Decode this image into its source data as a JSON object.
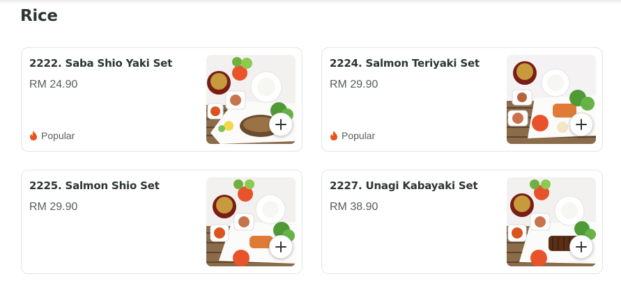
{
  "section": {
    "title": "Rice"
  },
  "items": [
    {
      "name": "2222. Saba Shio Yaki Set",
      "price": "RM 24.90",
      "badge": "Popular",
      "dish": "grilled mackerel set"
    },
    {
      "name": "2224. Salmon Teriyaki Set",
      "price": "RM 29.90",
      "badge": "Popular",
      "dish": "salmon teriyaki set"
    },
    {
      "name": "2225. Salmon Shio Set",
      "price": "RM 29.90",
      "badge": "",
      "dish": "salt grilled salmon set"
    },
    {
      "name": "2227. Unagi Kabayaki Set",
      "price": "RM 38.90",
      "badge": "",
      "dish": "grilled eel set"
    }
  ],
  "icons": {
    "add": "plus-icon",
    "popular": "flame-icon"
  },
  "colors": {
    "flame": "#e8541a",
    "border": "#e2e5e5",
    "text": "#2e3333",
    "muted": "#585c5c"
  }
}
